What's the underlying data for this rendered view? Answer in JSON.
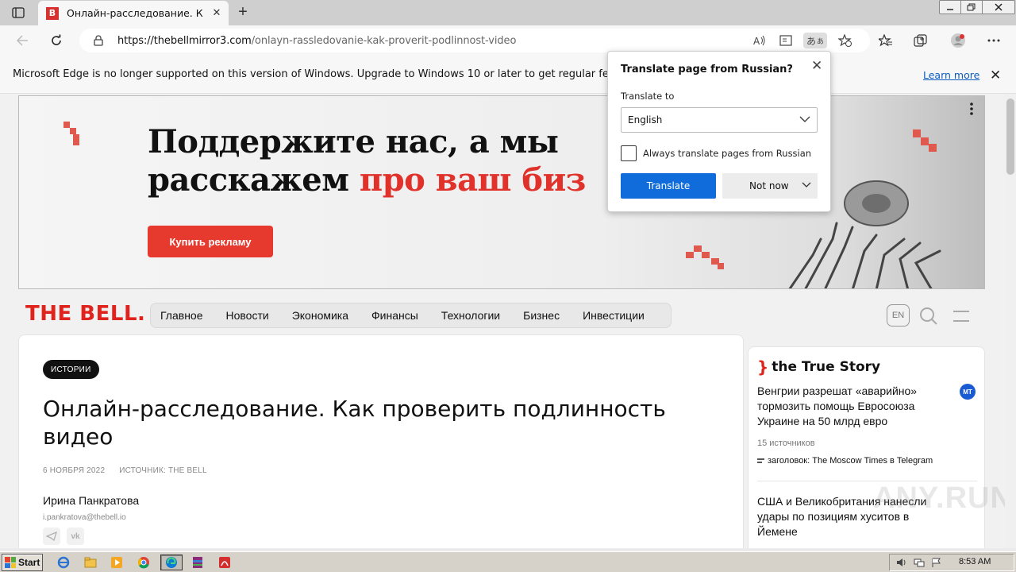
{
  "browser": {
    "tab": {
      "favicon_letter": "B",
      "title": "Онлайн-расследование. Как пр"
    },
    "url": {
      "host": "https://thebellmirror3.com",
      "path": "/onlayn-rassledovanie-kak-proverit-podlinnost-video"
    },
    "translate_icon_text": "あ"
  },
  "infobar": {
    "message": "Microsoft Edge is no longer supported on this version of Windows. Upgrade to Windows 10 or later to get regular feature and",
    "learn_more": "Learn more"
  },
  "banner": {
    "line1": "Поддержите нас, а мы",
    "line2_black": "расскажем ",
    "line2_red": "про ваш биз",
    "button": "Купить рекламу"
  },
  "site": {
    "logo": "THE BELL.",
    "nav": [
      "Главное",
      "Новости",
      "Экономика",
      "Финансы",
      "Технологии",
      "Бизнес",
      "Инвестиции"
    ],
    "lang_button": "EN"
  },
  "article": {
    "tag": "ИСТОРИИ",
    "title": "Онлайн-расследование. Как проверить подлинность видео",
    "date": "6 НОЯБРЯ 2022",
    "source": "ИСТОЧНИК: THE BELL",
    "author": "Ирина Панкратова",
    "email": "i.pankratova@thebell.io",
    "share": [
      "telegram-icon",
      "vk-icon"
    ]
  },
  "sidebar": {
    "logo_bracket": "}",
    "logo_text": "the True Story",
    "story1": {
      "headline": "Венгрии разрешат «аварийно» тормозить помощь Евросоюза Украине на 50 млрд евро",
      "badge": "MT",
      "sources_count": "15 источников",
      "source": "заголовок: The Moscow Times в Telegram"
    },
    "story2": {
      "headline": "США и Великобритания нанесли удары по позициям хуситов в Йемене"
    }
  },
  "watermark": "ANY.RUN",
  "translate_popup": {
    "title": "Translate page from Russian?",
    "translate_to_label": "Translate to",
    "language": "English",
    "always_label": "Always translate pages from Russian",
    "always_checked": false,
    "translate_button": "Translate",
    "not_now_button": "Not now"
  },
  "taskbar": {
    "start": "Start",
    "apps": [
      "ie-icon",
      "folder-icon",
      "media-player-icon",
      "chrome-icon",
      "edge-icon",
      "winrar-icon",
      "acrobat-icon"
    ],
    "active_app": "edge-icon",
    "clock": "8:53 AM"
  },
  "colors": {
    "accent_red": "#e1231d",
    "button_red": "#e63a2e",
    "translate_blue": "#0f6cda",
    "link_blue": "#0b5cbf"
  }
}
